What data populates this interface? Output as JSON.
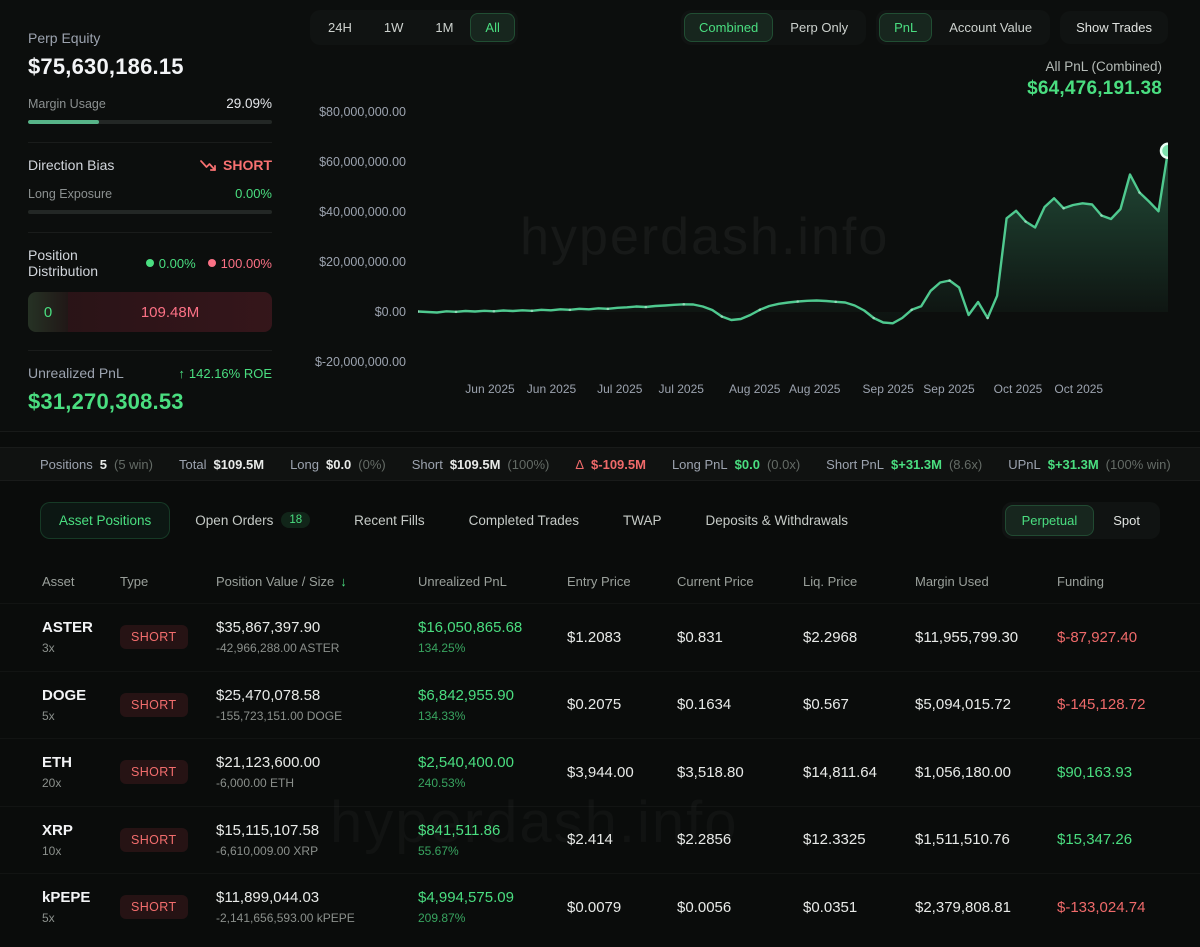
{
  "colors": {
    "accent_green": "#4ade80",
    "chart_line": "#4fc98f",
    "red": "#ef6a6a",
    "pink": "#fb7185"
  },
  "watermark": "hyperdash.info",
  "left_panel": {
    "perp_equity_label": "Perp Equity",
    "perp_equity_value": "$75,630,186.15",
    "margin_usage_label": "Margin Usage",
    "margin_usage_value": "29.09%",
    "margin_usage_pct": 29.09,
    "direction_bias_label": "Direction Bias",
    "direction_bias_value": "SHORT",
    "long_exposure_label": "Long Exposure",
    "long_exposure_value": "0.00%",
    "long_exposure_pct": 0,
    "position_distribution_label": "Position Distribution",
    "distribution_long_pct": "0.00%",
    "distribution_short_pct": "100.00%",
    "distribution_long_value": "0",
    "distribution_short_value": "109.48M",
    "unrealized_pnl_label": "Unrealized PnL",
    "roe_arrow": "↑",
    "roe_text": "142.16% ROE",
    "unrealized_pnl_value": "$31,270,308.53"
  },
  "chart_header": {
    "ranges": [
      "24H",
      "1W",
      "1M",
      "All"
    ],
    "active_range": "All",
    "mode_toggle": [
      "Combined",
      "Perp Only"
    ],
    "active_mode": "Combined",
    "metric_toggle": [
      "PnL",
      "Account Value"
    ],
    "active_metric": "PnL",
    "show_trades_label": "Show Trades",
    "all_pnl_label": "All PnL (Combined)",
    "all_pnl_value": "$64,476,191.38"
  },
  "chart_data": {
    "type": "area",
    "title": "All PnL (Combined)",
    "legend": false,
    "grid": false,
    "y_unit": "USD",
    "ylim_millions": [
      -24,
      84
    ],
    "y_tick_labels": [
      "$80,000,000.00",
      "$60,000,000.00",
      "$40,000,000.00",
      "$20,000,000.00",
      "$0.00",
      "$-20,000,000.00"
    ],
    "y_tick_values_millions": [
      80,
      60,
      40,
      20,
      0,
      -20
    ],
    "x_tick_labels": [
      "Jun 2025",
      "Jun 2025",
      "Jul 2025",
      "Jul 2025",
      "Aug 2025",
      "Aug 2025",
      "Sep 2025",
      "Sep 2025",
      "Oct 2025",
      "Oct 2025"
    ],
    "x_tick_pos_pct": [
      9.6,
      17.8,
      26.9,
      35.1,
      44.9,
      52.9,
      62.7,
      70.8,
      80.0,
      88.1
    ],
    "series": [
      {
        "name": "All PnL (Combined)",
        "unit": "$ millions",
        "values": [
          0.2,
          0.0,
          -0.2,
          0.3,
          0.1,
          0.4,
          0.2,
          0.5,
          0.3,
          0.6,
          0.4,
          0.7,
          0.5,
          0.9,
          0.7,
          1.1,
          0.9,
          1.3,
          1.1,
          1.5,
          1.3,
          1.7,
          1.9,
          2.2,
          2.0,
          2.4,
          2.6,
          2.9,
          3.1,
          3.0,
          2.2,
          0.8,
          -1.8,
          -3.2,
          -2.8,
          -1.2,
          0.9,
          2.4,
          3.3,
          3.8,
          4.2,
          4.5,
          4.6,
          4.4,
          4.1,
          3.8,
          2.6,
          0.6,
          -2.4,
          -4.2,
          -4.5,
          -2.4,
          0.9,
          2.3,
          8.5,
          11.8,
          12.6,
          9.8,
          -1.2,
          4.0,
          -2.4,
          6.5,
          37.5,
          40.5,
          36.2,
          33.8,
          42.0,
          45.5,
          41.5,
          42.8,
          43.5,
          43.0,
          38.6,
          37.2,
          41.2,
          55.0,
          47.8,
          44.2,
          40.3,
          64.5
        ]
      }
    ],
    "end_value_label": "$64,476,191.38"
  },
  "stats_bar": [
    {
      "label": "Positions",
      "value": "5",
      "suffix": "(5 win)",
      "color": "white"
    },
    {
      "label": "Total",
      "value": "$109.5M",
      "suffix": "",
      "color": "white"
    },
    {
      "label": "Long",
      "value": "$0.0",
      "suffix": "(0%)",
      "color": "white"
    },
    {
      "label": "Short",
      "value": "$109.5M",
      "suffix": "(100%)",
      "color": "white"
    },
    {
      "label": "Δ",
      "value": "$-109.5M",
      "suffix": "",
      "color": "red",
      "label_red": true
    },
    {
      "label": "Long PnL",
      "value": "$0.0",
      "suffix": "(0.0x)",
      "color": "green"
    },
    {
      "label": "Short PnL",
      "value": "$+31.3M",
      "suffix": "(8.6x)",
      "color": "green"
    },
    {
      "label": "UPnL",
      "value": "$+31.3M",
      "suffix": "(100% win)",
      "color": "green"
    }
  ],
  "tabs": [
    {
      "label": "Asset Positions",
      "active": true
    },
    {
      "label": "Open Orders",
      "badge": "18"
    },
    {
      "label": "Recent Fills"
    },
    {
      "label": "Completed Trades"
    },
    {
      "label": "TWAP"
    },
    {
      "label": "Deposits & Withdrawals"
    }
  ],
  "market_toggle": [
    "Perpetual",
    "Spot"
  ],
  "active_market": "Perpetual",
  "table": {
    "headers": [
      "Asset",
      "Type",
      "Position Value / Size",
      "Unrealized PnL",
      "Entry Price",
      "Current Price",
      "Liq. Price",
      "Margin Used",
      "Funding"
    ],
    "sorted_column": "Position Value / Size",
    "sort_arrow": "↓",
    "rows": [
      {
        "asset": "ASTER",
        "leverage": "3x",
        "type": "SHORT",
        "position_value": "$35,867,397.90",
        "size": "-42,966,288.00 ASTER",
        "unrealized_pnl": "$16,050,865.68",
        "unrealized_pnl_pct": "134.25%",
        "entry_price": "$1.2083",
        "current_price": "$0.831",
        "liq_price": "$2.2968",
        "margin_used": "$11,955,799.30",
        "funding": "$-87,927.40",
        "funding_color": "red"
      },
      {
        "asset": "DOGE",
        "leverage": "5x",
        "type": "SHORT",
        "position_value": "$25,470,078.58",
        "size": "-155,723,151.00 DOGE",
        "unrealized_pnl": "$6,842,955.90",
        "unrealized_pnl_pct": "134.33%",
        "entry_price": "$0.2075",
        "current_price": "$0.1634",
        "liq_price": "$0.567",
        "margin_used": "$5,094,015.72",
        "funding": "$-145,128.72",
        "funding_color": "red"
      },
      {
        "asset": "ETH",
        "leverage": "20x",
        "type": "SHORT",
        "position_value": "$21,123,600.00",
        "size": "-6,000.00 ETH",
        "unrealized_pnl": "$2,540,400.00",
        "unrealized_pnl_pct": "240.53%",
        "entry_price": "$3,944.00",
        "current_price": "$3,518.80",
        "liq_price": "$14,811.64",
        "margin_used": "$1,056,180.00",
        "funding": "$90,163.93",
        "funding_color": "green"
      },
      {
        "asset": "XRP",
        "leverage": "10x",
        "type": "SHORT",
        "position_value": "$15,115,107.58",
        "size": "-6,610,009.00 XRP",
        "unrealized_pnl": "$841,511.86",
        "unrealized_pnl_pct": "55.67%",
        "entry_price": "$2.414",
        "current_price": "$2.2856",
        "liq_price": "$12.3325",
        "margin_used": "$1,511,510.76",
        "funding": "$15,347.26",
        "funding_color": "green"
      },
      {
        "asset": "kPEPE",
        "leverage": "5x",
        "type": "SHORT",
        "position_value": "$11,899,044.03",
        "size": "-2,141,656,593.00 kPEPE",
        "unrealized_pnl": "$4,994,575.09",
        "unrealized_pnl_pct": "209.87%",
        "entry_price": "$0.0079",
        "current_price": "$0.0056",
        "liq_price": "$0.0351",
        "margin_used": "$2,379,808.81",
        "funding": "$-133,024.74",
        "funding_color": "red"
      }
    ]
  }
}
